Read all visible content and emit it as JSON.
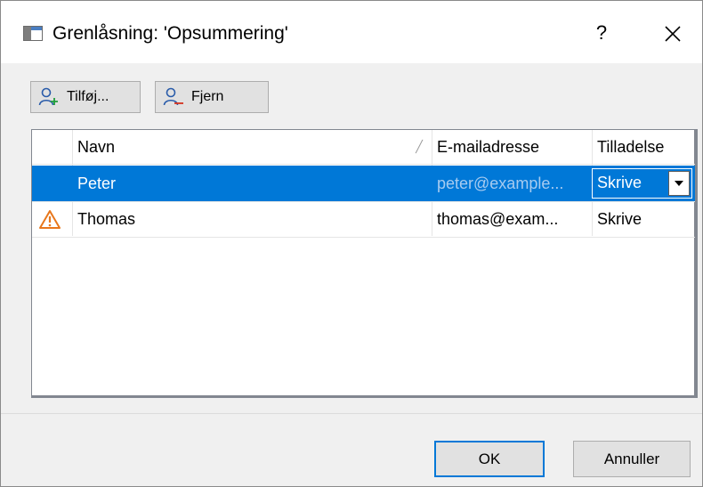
{
  "dialog": {
    "title": "Grenlåsning: 'Opsummering'",
    "help_label": "?",
    "close_icon": "close-icon"
  },
  "toolbar": {
    "add_label": "Tilføj...",
    "add_icon": "add-user-icon",
    "remove_label": "Fjern",
    "remove_icon": "remove-user-icon"
  },
  "table": {
    "columns": [
      "",
      "Navn",
      "E-mailadresse",
      "Tilladelse"
    ],
    "sorted_column": "Navn",
    "rows": [
      {
        "warning": false,
        "name": "Peter",
        "email": "peter@example...",
        "permission": "Skrive",
        "selected": true
      },
      {
        "warning": true,
        "name": "Thomas",
        "email": "thomas@exam...",
        "permission": "Skrive",
        "selected": false
      }
    ]
  },
  "buttons": {
    "ok_label": "OK",
    "cancel_label": "Annuller"
  },
  "colors": {
    "accent": "#0078d7",
    "warning": "#e8771c",
    "dialog_bg": "#f0f0f0"
  }
}
